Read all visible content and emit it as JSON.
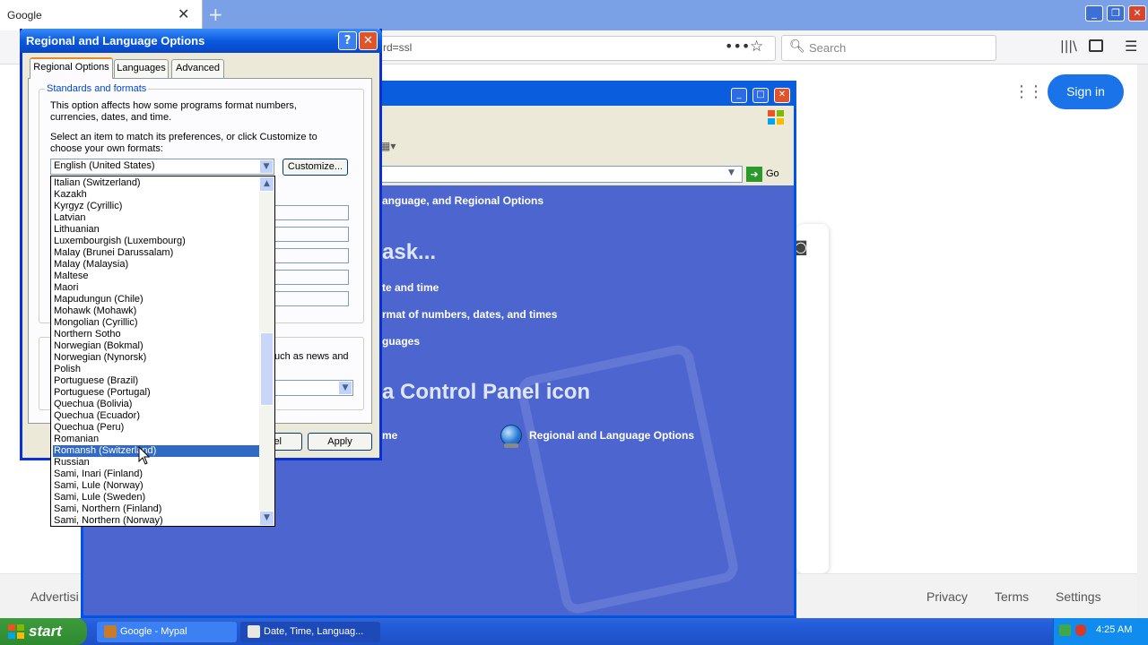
{
  "browser": {
    "tab_title": "Google",
    "url_fragment": "rd=ssl",
    "search_placeholder": "Search",
    "sign_in": "Sign in",
    "footer": {
      "advertising": "Advertisi",
      "privacy": "Privacy",
      "terms": "Terms",
      "settings": "Settings"
    }
  },
  "control_panel": {
    "go_label": "Go",
    "breadcrumb": "anguage, and Regional Options",
    "pick_task": "ask...",
    "task1": "te and time",
    "task2": "rmat of numbers, dates, and times",
    "task3": "guages",
    "pick_icon": "a Control Panel icon",
    "icon1": "me",
    "icon2": "Regional and Language Options"
  },
  "dialog": {
    "title": "Regional and Language Options",
    "tabs": [
      "Regional Options",
      "Languages",
      "Advanced"
    ],
    "group_title": "Standards and formats",
    "desc1": "This option affects how some programs format numbers, currencies, dates, and time.",
    "desc2": "Select an item to match its preferences, or click Customize to choose your own formats:",
    "selected_value": "English (United States)",
    "customize": "Customize...",
    "location_fragment": "uch as news and",
    "cancel": "el",
    "apply": "Apply",
    "dropdown_items": [
      "Italian (Switzerland)",
      "Kazakh",
      "Kyrgyz (Cyrillic)",
      "Latvian",
      "Lithuanian",
      "Luxembourgish (Luxembourg)",
      "Malay (Brunei Darussalam)",
      "Malay (Malaysia)",
      "Maltese",
      "Maori",
      "Mapudungun (Chile)",
      "Mohawk (Mohawk)",
      "Mongolian (Cyrillic)",
      "Northern Sotho",
      "Norwegian (Bokmal)",
      "Norwegian (Nynorsk)",
      "Polish",
      "Portuguese (Brazil)",
      "Portuguese (Portugal)",
      "Quechua (Bolivia)",
      "Quechua (Ecuador)",
      "Quechua (Peru)",
      "Romanian",
      "Romansh (Switzerland)",
      "Russian",
      "Sami, Inari (Finland)",
      "Sami, Lule (Norway)",
      "Sami, Lule (Sweden)",
      "Sami, Northern (Finland)",
      "Sami, Northern (Norway)"
    ],
    "highlighted_item": "Romansh (Switzerland)"
  },
  "taskbar": {
    "start": "start",
    "items": [
      "Google - Mypal",
      "Date, Time, Languag..."
    ],
    "clock": "4:25 AM"
  },
  "colors": {
    "xp_blue": "#0a5ede",
    "selection": "#316ac5",
    "google_blue": "#1a73e8",
    "start_green": "#3c9b3c"
  }
}
